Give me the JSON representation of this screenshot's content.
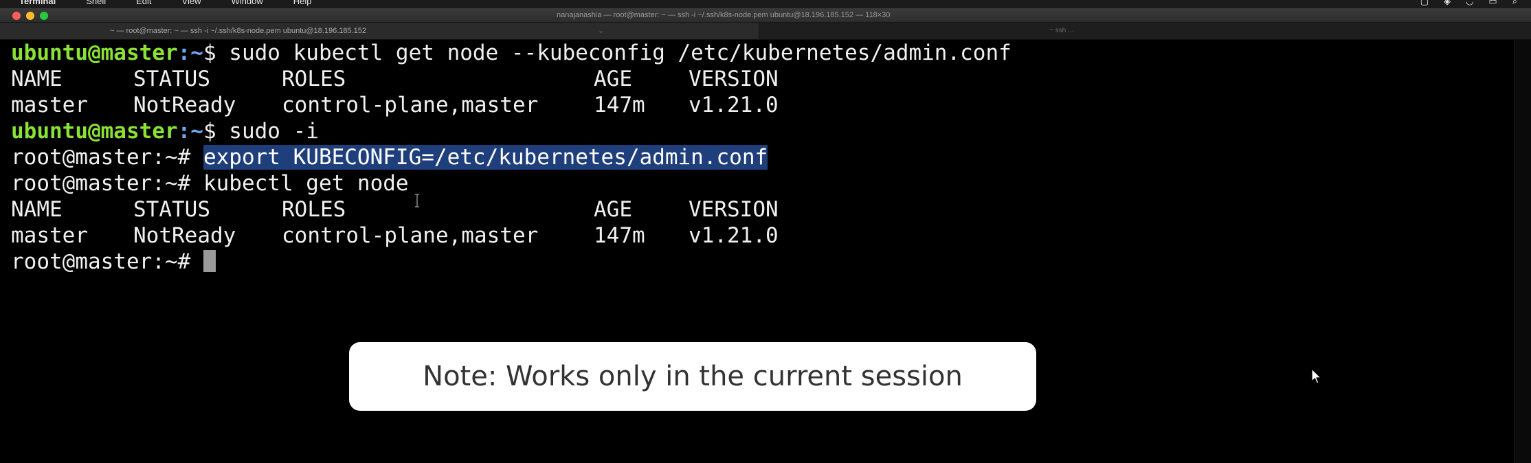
{
  "menubar": {
    "apple_glyph": "",
    "app_name": "Terminal",
    "items": [
      "Shell",
      "Edit",
      "View",
      "Window",
      "Help"
    ]
  },
  "window": {
    "title": "nanajanashia — root@master: ~ — ssh -i ~/.ssh/k8s-node.pem ubuntu@18.196.185.152 — 118×30"
  },
  "tabs": [
    {
      "label": "~ — root@master: ~ — ssh -i ~/.ssh/k8s-node.pem ubuntu@18.196.185.152",
      "active": true
    },
    {
      "label": "~ ssh ...",
      "active": false
    }
  ],
  "terminal": {
    "prompt_user": {
      "user_host": "ubuntu@master",
      "path": ":~",
      "symbol": "$ "
    },
    "prompt_root": "root@master:~# ",
    "lines": [
      {
        "type": "user_cmd",
        "command": "sudo kubectl get node --kubeconfig /etc/kubernetes/admin.conf"
      },
      {
        "type": "table_header",
        "cols": [
          "NAME",
          "STATUS",
          "ROLES",
          "AGE",
          "VERSION"
        ]
      },
      {
        "type": "table_row",
        "cols": [
          "master",
          "NotReady",
          "control-plane,master",
          "147m",
          "v1.21.0"
        ]
      },
      {
        "type": "user_cmd",
        "command": "sudo -i"
      },
      {
        "type": "root_cmd",
        "command": "export KUBECONFIG=/etc/kubernetes/admin.conf",
        "selected": true
      },
      {
        "type": "root_cmd",
        "command": "kubectl get node"
      },
      {
        "type": "table_header",
        "cols": [
          "NAME",
          "STATUS",
          "ROLES",
          "AGE",
          "VERSION"
        ]
      },
      {
        "type": "table_row",
        "cols": [
          "master",
          "NotReady",
          "control-plane,master",
          "147m",
          "v1.21.0"
        ]
      },
      {
        "type": "root_prompt"
      }
    ]
  },
  "note": {
    "text": "Note: Works only in the current session"
  },
  "colors": {
    "prompt_user": "#8ae234",
    "prompt_path": "#6fa8f0",
    "selection": "#1f3e7c",
    "terminal_bg": "#000000",
    "terminal_fg": "#f0f0f0"
  },
  "icons": {
    "close": "close-traffic-light-icon",
    "minimize": "minimize-traffic-light-icon",
    "maximize": "maximize-traffic-light-icon",
    "pointer": "mouse-pointer-icon",
    "ibeam": "text-cursor-icon"
  }
}
